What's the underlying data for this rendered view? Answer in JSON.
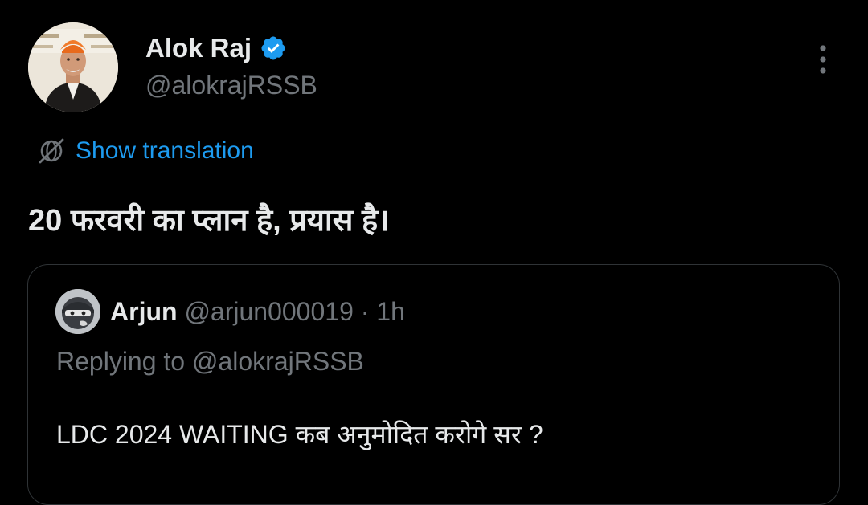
{
  "tweet": {
    "author": {
      "name": "Alok Raj",
      "handle": "@alokrajRSSB",
      "verified": true,
      "avatar": "avatar-photo-man-orange-turban"
    },
    "translate_label": "Show translation",
    "text": "20 फरवरी का प्लान है, प्रयास है।",
    "more_icon": "more-vertical-icon"
  },
  "quote": {
    "author": {
      "name": "Arjun",
      "handle": "@arjun000019",
      "avatar": "avatar-masked-character"
    },
    "separator": " · ",
    "time": "1h",
    "replying_to": "Replying to @alokrajRSSB",
    "text": "LDC 2024 WAITING कब अनुमोदित करोगे सर ?"
  },
  "colors": {
    "background": "#000000",
    "primary_text": "#e7e9ea",
    "secondary_text": "#71767b",
    "accent": "#1d9bf0",
    "border": "#2f3336"
  }
}
